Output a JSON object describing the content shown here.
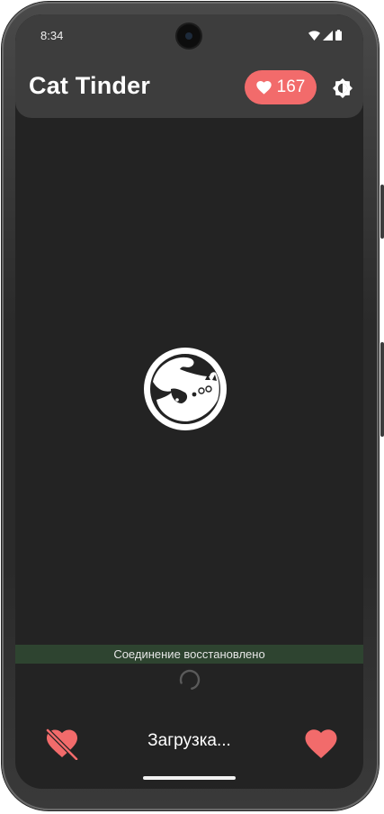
{
  "status_bar": {
    "time": "8:34",
    "icons": [
      "wifi-icon",
      "signal-icon",
      "battery-icon"
    ]
  },
  "app_bar": {
    "title": "Cat Tinder",
    "likes_count": "167",
    "likes_icon": "heart-icon",
    "theme_icon": "brightness-icon"
  },
  "main": {
    "logo": "cat-logo"
  },
  "snackbar": {
    "message": "Соединение восстановлено"
  },
  "bottom": {
    "dislike_icon": "heart-broken-icon",
    "status_text": "Загрузка...",
    "like_icon": "heart-icon"
  },
  "colors": {
    "accent": "#f26b6b",
    "background": "#232323",
    "appbar": "#3d3d3d",
    "snackbar": "#2e4430"
  }
}
